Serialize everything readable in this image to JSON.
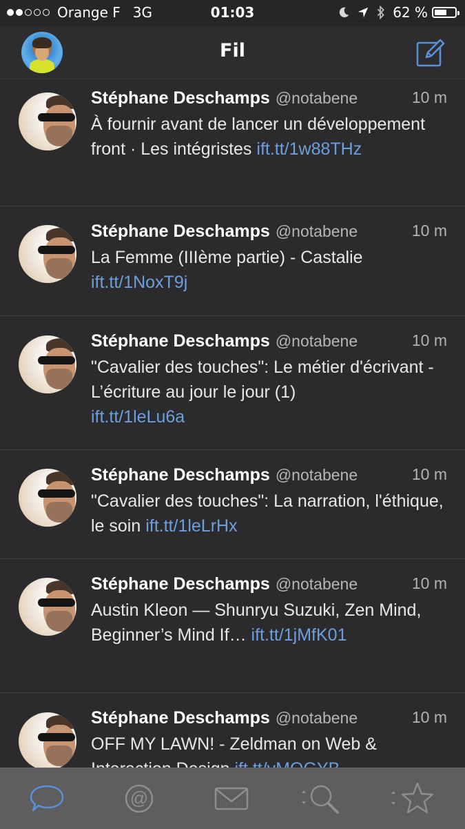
{
  "status_bar": {
    "carrier": "Orange F",
    "network": "3G",
    "time": "01:03",
    "battery_percent": "62 %",
    "battery_level": 0.62
  },
  "nav": {
    "title": "Fil"
  },
  "tweets": [
    {
      "name": "Stéphane Deschamps",
      "handle": "@notabene",
      "time": "10 m",
      "text": "À fournir avant de lancer un développement front · Les intégristes ",
      "link": "ift.tt/1w88THz"
    },
    {
      "name": "Stéphane Deschamps",
      "handle": "@notabene",
      "time": "10 m",
      "text": "La Femme (IIIème partie) - Castalie ",
      "link": "ift.tt/1NoxT9j"
    },
    {
      "name": "Stéphane Deschamps",
      "handle": "@notabene",
      "time": "10 m",
      "text": "\"Cavalier des touches\": Le métier d'écrivant - L’écriture au jour le jour (1) ",
      "link": "ift.tt/1leLu6a"
    },
    {
      "name": "Stéphane Deschamps",
      "handle": "@notabene",
      "time": "10 m",
      "text": "\"Cavalier des touches\": La narration, l'éthique, le soin ",
      "link": "ift.tt/1leLrHx"
    },
    {
      "name": "Stéphane Deschamps",
      "handle": "@notabene",
      "time": "10 m",
      "text": "Austin Kleon — Shunryu Suzuki, Zen Mind, Beginner’s Mind If… ",
      "link": "ift.tt/1jMfK01"
    },
    {
      "name": "Stéphane Deschamps",
      "handle": "@notabene",
      "time": "10 m",
      "text": "OFF MY LAWN! - Zeldman on Web & Interaction Design ",
      "link": "ift.tt/vMOGYB"
    }
  ],
  "tabs": [
    {
      "icon": "speech-bubble-icon",
      "active": true
    },
    {
      "icon": "at-sign-icon",
      "active": false
    },
    {
      "icon": "envelope-icon",
      "active": false
    },
    {
      "icon": "search-icon",
      "active": false
    },
    {
      "icon": "star-icon",
      "active": false
    }
  ],
  "colors": {
    "background": "#2b2b2d",
    "link": "#6d9fdc",
    "tab_active": "#5b8fd6",
    "tab_inactive": "#8e8e90",
    "tabbar": "#5e5e60"
  }
}
